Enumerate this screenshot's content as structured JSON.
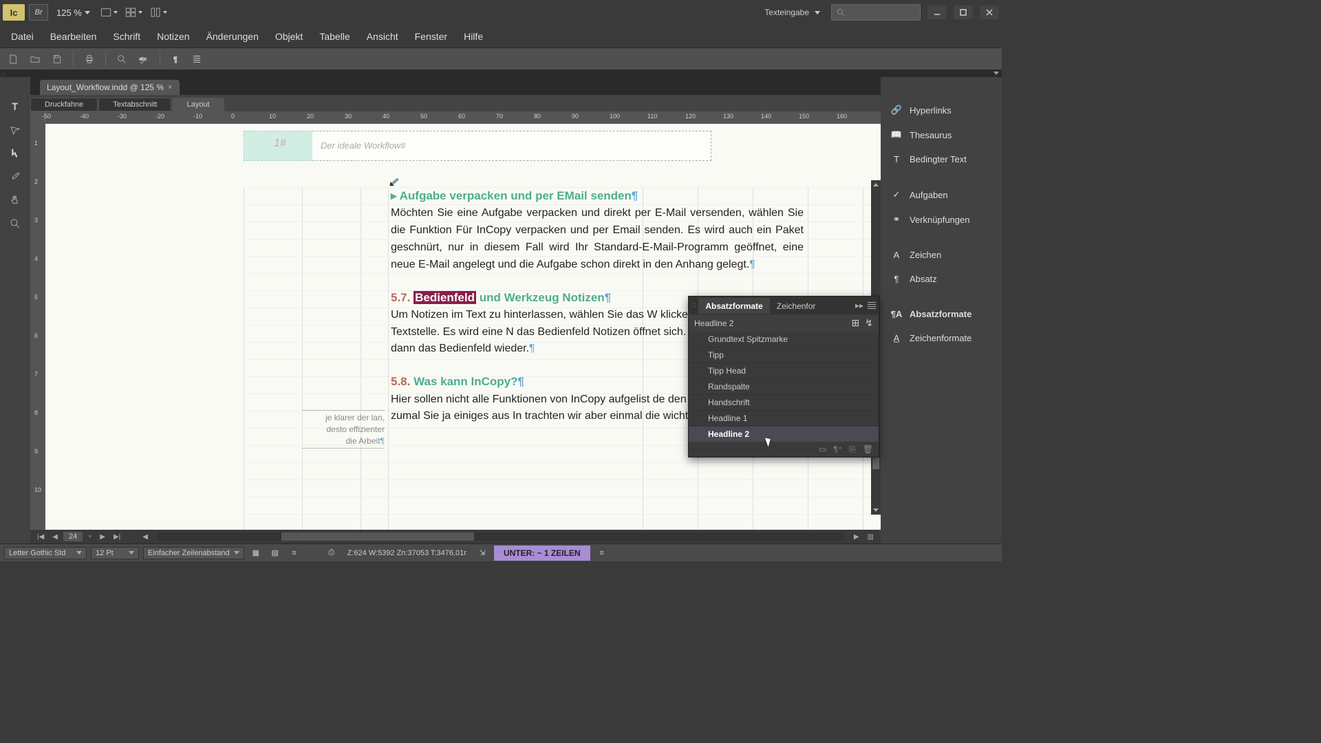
{
  "titlebar": {
    "app": "Ic",
    "bridge": "Br",
    "zoom": "125 %",
    "workspace": "Texteingabe",
    "search_placeholder": ""
  },
  "menu": [
    "Datei",
    "Bearbeiten",
    "Schrift",
    "Notizen",
    "Änderungen",
    "Objekt",
    "Tabelle",
    "Ansicht",
    "Fenster",
    "Hilfe"
  ],
  "doc": {
    "tab": "Layout_Workflow.indd @ 125 %",
    "view_tabs": [
      "Druckfahne",
      "Textabschnitt",
      "Layout"
    ],
    "active_view": 2,
    "ruler_h": [
      "-50",
      "-40",
      "-30",
      "-20",
      "-10",
      "0",
      "10",
      "20",
      "30",
      "40",
      "50",
      "60",
      "70",
      "80",
      "90",
      "100",
      "110",
      "120",
      "130",
      "140",
      "150",
      "160"
    ],
    "ruler_v": [
      "1",
      "2",
      "3",
      "4",
      "5",
      "6",
      "7",
      "8",
      "9",
      "10"
    ],
    "header_num": "1#",
    "header_text": "Der ideale Workflow#",
    "h2a": {
      "num": "",
      "text": "Aufgabe verpacken und per EMail senden"
    },
    "p1": "Möchten Sie eine Aufgabe verpacken und direkt per E-Mail versenden, wählen Sie die Funktion Für InCopy verpacken und per Email senden. Es wird auch ein Paket geschnürt, nur in diesem Fall wird Ihr Standard-E-Mail-Programm geöffnet, eine neue E-Mail angelegt und die Aufgabe schon direkt in den Anhang gelegt.",
    "h2b": {
      "num": "5.7.",
      "mark": "Bedienfeld",
      "rest": " und Werkzeug Notizen"
    },
    "p2": "Um Notizen im Text zu hinterlassen, wählen Sie das W              klicken an die entsprechende Textstelle. Es wird eine N                das Bedienfeld Notizen öffnet sich. Geben Sie Ihre Not                Sie dann das Bedienfeld wieder.",
    "h2c": {
      "num": "5.8.",
      "text": "Was kann InCopy?"
    },
    "p3": "Hier sollen nicht alle Funktionen von InCopy aufgelist              de den Rahmen sprengen, zumal Sie ja einiges aus In                trachten wir aber einmal die wichtigsten Funktionen i",
    "margin_note": "je klarer der lan,\ndesto effizienter\ndie Arbeit",
    "page_num": "24"
  },
  "right_panels": [
    "Hyperlinks",
    "Thesaurus",
    "Bedingter Text",
    "Aufgaben",
    "Verknüpfungen",
    "Zeichen",
    "Absatz",
    "Absatzformate",
    "Zeichenformate"
  ],
  "panel": {
    "tab1": "Absatzformate",
    "tab2": "Zeichenfor",
    "current": "Headline 2",
    "items": [
      "Grundtext Spitzmarke",
      "Tipp",
      "Tipp Head",
      "Randspalte",
      "Handschrift",
      "Headline 1",
      "Headline 2"
    ],
    "selected": 6
  },
  "status": {
    "font": "Letter Gothic Std",
    "size": "12 Pt",
    "leading": "Einfacher Zeilenabstand",
    "stats": "Z:624    W:5392    Zn:37053   T:3476,01r",
    "alert": "UNTER:  ~ 1 ZEILEN"
  }
}
